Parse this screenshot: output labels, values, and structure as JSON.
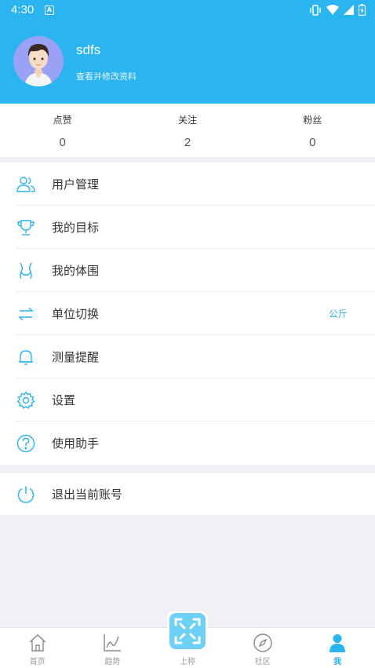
{
  "status_bar": {
    "time": "4:30",
    "notification_icon": "A"
  },
  "profile": {
    "username": "sdfs",
    "link_text": "查看并修改资料"
  },
  "stats": [
    {
      "label": "点赞",
      "value": "0"
    },
    {
      "label": "关注",
      "value": "2"
    },
    {
      "label": "粉丝",
      "value": "0"
    }
  ],
  "menu": [
    {
      "label": "用户管理",
      "icon": "users-icon"
    },
    {
      "label": "我的目标",
      "icon": "trophy-icon"
    },
    {
      "label": "我的体围",
      "icon": "body-shape-icon"
    },
    {
      "label": "单位切换",
      "icon": "swap-icon",
      "extra": "公斤"
    },
    {
      "label": "测量提醒",
      "icon": "bell-icon"
    },
    {
      "label": "设置",
      "icon": "gear-icon"
    },
    {
      "label": "使用助手",
      "icon": "help-icon"
    }
  ],
  "logout": {
    "label": "退出当前账号",
    "icon": "power-icon"
  },
  "tabbar": [
    {
      "label": "首页",
      "icon": "home-icon"
    },
    {
      "label": "趋势",
      "icon": "trend-icon"
    },
    {
      "label": "上称",
      "icon": "scan-icon"
    },
    {
      "label": "社区",
      "icon": "compass-icon"
    },
    {
      "label": "我",
      "icon": "user-icon",
      "active": true
    }
  ],
  "colors": {
    "accent": "#2ab4f0",
    "scan_button": "#6fd0f6",
    "background": "#f0f1f5"
  }
}
